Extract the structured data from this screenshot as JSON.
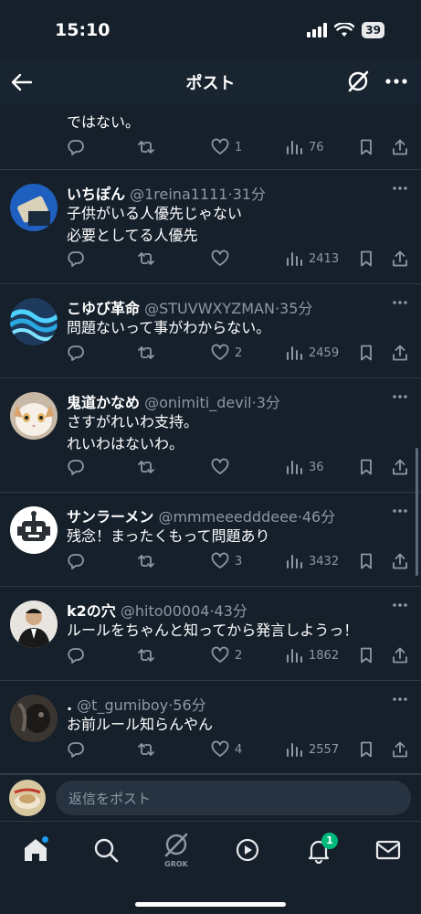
{
  "status_bar": {
    "time": "15:10",
    "battery": "39"
  },
  "header": {
    "title": "ポスト"
  },
  "partial_post": {
    "text": "ではない。",
    "likes": "1",
    "views": "76"
  },
  "posts": [
    {
      "name": "いちぽん",
      "handle": "@1reina1111",
      "time": "31分",
      "lines": [
        "子供がいる人優先じゃない",
        "必要としてる人優先"
      ],
      "likes": "",
      "views": "2413"
    },
    {
      "name": "こゆび革命",
      "handle": "@STUVWXYZMAN",
      "time": "35分",
      "lines": [
        "問題ないって事がわからない。"
      ],
      "likes": "2",
      "views": "2459"
    },
    {
      "name": "鬼道かなめ",
      "handle": "@onimiti_devil",
      "time": "3分",
      "lines": [
        "さすがれいわ支持。",
        "れいわはないわ。"
      ],
      "likes": "",
      "views": "36"
    },
    {
      "name": "サンラーメン",
      "handle": "@mmmeeedddeee",
      "time": "46分",
      "lines": [
        "残念！まったくもって問題あり"
      ],
      "likes": "3",
      "views": "3432"
    },
    {
      "name": "k2の穴",
      "handle": "@hito00004",
      "time": "43分",
      "lines": [
        "ルールをちゃんと知ってから発言しようっ！"
      ],
      "likes": "2",
      "views": "1862"
    },
    {
      "name": ".",
      "handle": "@t_gumiboy",
      "time": "56分",
      "lines": [
        "お前ルール知らんやん"
      ],
      "likes": "4",
      "views": "2557"
    }
  ],
  "reply": {
    "placeholder": "返信をポスト"
  },
  "tabbar": {
    "grok_label": "GROK",
    "notification_count": "1"
  },
  "icons": [
    "back-arrow-icon",
    "grok-icon",
    "more-icon",
    "reply-icon",
    "repost-icon",
    "heart-icon",
    "views-icon",
    "bookmark-icon",
    "share-icon",
    "home-icon",
    "search-icon",
    "video-icon",
    "bell-icon",
    "mail-icon"
  ],
  "colors": {
    "background": "#15202b",
    "secondary_text": "#8b98a5",
    "divider": "#2f3b47",
    "badge": "#00ba7c"
  }
}
